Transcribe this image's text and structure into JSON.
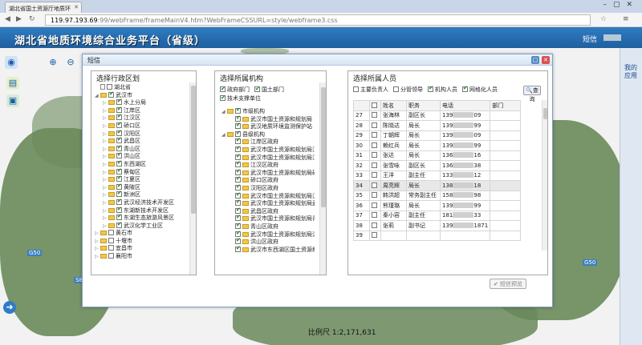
{
  "browser": {
    "tab_title": "湖北省国土资源厅地质环",
    "url_host": "119.97.193.69",
    "url_rest": ":99/webFrame/frameMainV4.htm?WebFrameCSSURL=style/webframe3.css"
  },
  "app": {
    "title": "湖北省地质环境综合业务平台（省级）",
    "sms_label": "短信",
    "side_label": "我的应用",
    "scale": "比例尺 1:2,171,631",
    "map_labels": [
      "G50",
      "G50",
      "S8"
    ]
  },
  "dialog": {
    "title": "短信",
    "region": {
      "title": "选择行政区划",
      "items": [
        {
          "label": "湖北省",
          "level": 0,
          "type": "doc",
          "checked": false,
          "expand": false
        },
        {
          "label": "武汉市",
          "level": 0,
          "type": "folder",
          "checked": true,
          "expand": true
        },
        {
          "label": "水上分局",
          "level": 1,
          "type": "folder",
          "checked": true,
          "expand": false
        },
        {
          "label": "江岸区",
          "level": 1,
          "type": "folder",
          "checked": true,
          "expand": false
        },
        {
          "label": "江汉区",
          "level": 1,
          "type": "folder",
          "checked": true,
          "expand": false
        },
        {
          "label": "硚口区",
          "level": 1,
          "type": "folder",
          "checked": true,
          "expand": false
        },
        {
          "label": "汉阳区",
          "level": 1,
          "type": "folder",
          "checked": true,
          "expand": false
        },
        {
          "label": "武昌区",
          "level": 1,
          "type": "folder",
          "checked": true,
          "expand": false
        },
        {
          "label": "青山区",
          "level": 1,
          "type": "folder",
          "checked": true,
          "expand": false
        },
        {
          "label": "洪山区",
          "level": 1,
          "type": "folder",
          "checked": true,
          "expand": false
        },
        {
          "label": "东西湖区",
          "level": 1,
          "type": "folder",
          "checked": true,
          "expand": false
        },
        {
          "label": "蔡甸区",
          "level": 1,
          "type": "folder",
          "checked": true,
          "expand": false
        },
        {
          "label": "江夏区",
          "level": 1,
          "type": "folder",
          "checked": true,
          "expand": false
        },
        {
          "label": "黄陂区",
          "level": 1,
          "type": "folder",
          "checked": true,
          "expand": false
        },
        {
          "label": "新洲区",
          "level": 1,
          "type": "folder",
          "checked": true,
          "expand": false
        },
        {
          "label": "武汉经济技术开发区",
          "level": 1,
          "type": "folder",
          "checked": true,
          "expand": false
        },
        {
          "label": "东湖新技术开发区",
          "level": 1,
          "type": "folder",
          "checked": true,
          "expand": false
        },
        {
          "label": "东湖生态旅游风景区",
          "level": 1,
          "type": "folder",
          "checked": true,
          "expand": false
        },
        {
          "label": "武汉化学工业区",
          "level": 1,
          "type": "folder",
          "checked": true,
          "expand": false
        },
        {
          "label": "黄石市",
          "level": 0,
          "type": "folder",
          "checked": false,
          "expand": false
        },
        {
          "label": "十堰市",
          "level": 0,
          "type": "folder",
          "checked": false,
          "expand": false
        },
        {
          "label": "宜昌市",
          "level": 0,
          "type": "folder",
          "checked": false,
          "expand": false
        },
        {
          "label": "襄阳市",
          "level": 0,
          "type": "folder",
          "checked": false,
          "expand": false
        }
      ]
    },
    "org": {
      "title": "选择所属机构",
      "filters": [
        {
          "label": "政府部门",
          "checked": true
        },
        {
          "label": "国土部门",
          "checked": true
        },
        {
          "label": "技术支撑单位",
          "checked": true
        }
      ],
      "items": [
        {
          "label": "市级机构",
          "level": 0,
          "checked": true
        },
        {
          "label": "武汉市国土资源和规划局",
          "level": 1,
          "checked": true
        },
        {
          "label": "武汉地质环境监测保护站",
          "level": 1,
          "checked": true
        },
        {
          "label": "县级机构",
          "level": 0,
          "checked": true
        },
        {
          "label": "江岸区政府",
          "level": 1,
          "checked": true
        },
        {
          "label": "武汉市国土资源和规划局江",
          "level": 1,
          "checked": true
        },
        {
          "label": "武汉市国土资源和规划局江",
          "level": 1,
          "checked": true
        },
        {
          "label": "江汉区政府",
          "level": 1,
          "checked": true
        },
        {
          "label": "武汉市国土资源和规划局硚",
          "level": 1,
          "checked": true
        },
        {
          "label": "硚口区政府",
          "level": 1,
          "checked": true
        },
        {
          "label": "汉阳区政府",
          "level": 1,
          "checked": true
        },
        {
          "label": "武汉市国土资源和规划局汉",
          "level": 1,
          "checked": true
        },
        {
          "label": "武汉市国土资源和规划局武",
          "level": 1,
          "checked": true
        },
        {
          "label": "武昌区政府",
          "level": 1,
          "checked": true
        },
        {
          "label": "武汉市国土资源和规划局青",
          "level": 1,
          "checked": true
        },
        {
          "label": "青山区政府",
          "level": 1,
          "checked": true
        },
        {
          "label": "武汉市国土资源和规划局洪",
          "level": 1,
          "checked": true
        },
        {
          "label": "洪山区政府",
          "level": 1,
          "checked": true
        },
        {
          "label": "武汉市东西湖区国土资源和",
          "level": 1,
          "checked": true
        }
      ]
    },
    "people": {
      "title": "选择所属人员",
      "filters": [
        {
          "label": "主要负责人",
          "checked": false
        },
        {
          "label": "分管领导",
          "checked": false
        },
        {
          "label": "机构人员",
          "checked": true
        },
        {
          "label": "网格化人员",
          "checked": true
        }
      ],
      "search_label": "查询",
      "columns": [
        "",
        "",
        "姓名",
        "职务",
        "电话",
        "部门"
      ],
      "rows": [
        {
          "no": "27",
          "name": "张海林",
          "title": "副区长",
          "phone_a": "139",
          "phone_b": "09"
        },
        {
          "no": "28",
          "name": "陈晓达",
          "title": "局长",
          "phone_a": "139",
          "phone_b": "99"
        },
        {
          "no": "29",
          "name": "丁朝辉",
          "title": "局长",
          "phone_a": "139",
          "phone_b": "09"
        },
        {
          "no": "30",
          "name": "赖红兵",
          "title": "局长",
          "phone_a": "139",
          "phone_b": "99"
        },
        {
          "no": "31",
          "name": "张达",
          "title": "局长",
          "phone_a": "136",
          "phone_b": "16"
        },
        {
          "no": "32",
          "name": "张雪咏",
          "title": "副区长",
          "phone_a": "136",
          "phone_b": "38"
        },
        {
          "no": "33",
          "name": "王洋",
          "title": "副主任",
          "phone_a": "133",
          "phone_b": "12"
        },
        {
          "no": "34",
          "name": "周亮辉",
          "title": "局长",
          "phone_a": "138",
          "phone_b": "18"
        },
        {
          "no": "35",
          "name": "韩洪超",
          "title": "常务副主任",
          "phone_a": "158",
          "phone_b": "98"
        },
        {
          "no": "36",
          "name": "熊瑾璐",
          "title": "局长",
          "phone_a": "139",
          "phone_b": "99"
        },
        {
          "no": "37",
          "name": "秦小容",
          "title": "副主任",
          "phone_a": "181",
          "phone_b": "33"
        },
        {
          "no": "38",
          "name": "张莉",
          "title": "副书记",
          "phone_a": "139",
          "phone_b": "1871"
        },
        {
          "no": "39",
          "name": "",
          "title": "",
          "phone_a": "",
          "phone_b": ""
        }
      ],
      "highlight_index": 7,
      "send_label": "短信预览"
    }
  }
}
